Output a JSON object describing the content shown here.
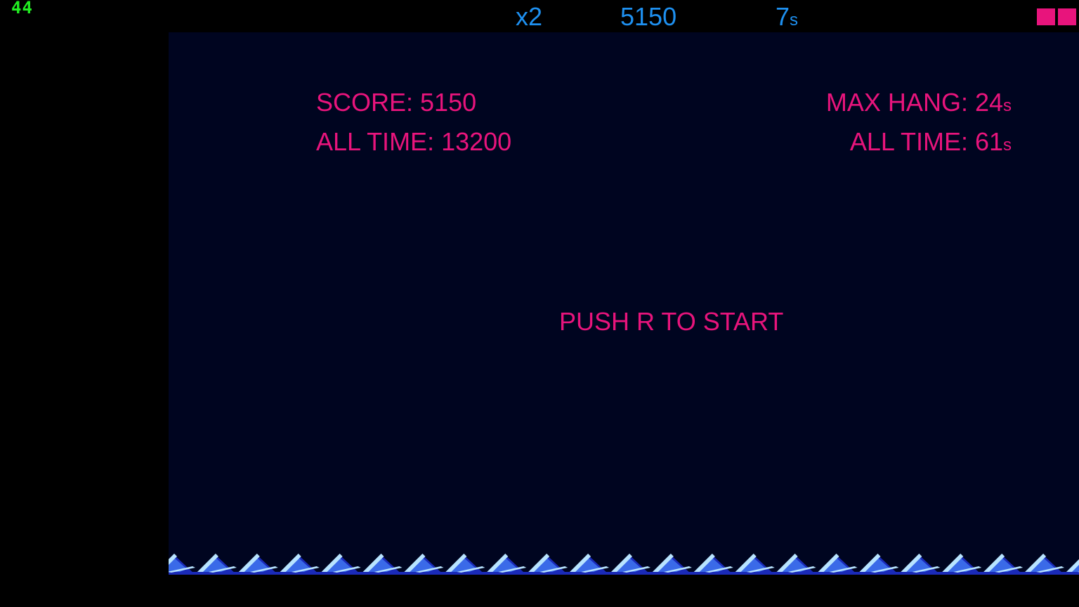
{
  "colors": {
    "background": "#000000",
    "playfield": "#000520",
    "hud_blue": "#1e90f0",
    "magenta": "#e8147c",
    "fps_green": "#22ee22",
    "wave_dark": "#1a2ab8",
    "wave_mid": "#3a6ae8",
    "wave_light": "#b8e4ff"
  },
  "fps": "44",
  "hud": {
    "multiplier": "x2",
    "score": "5150",
    "hang_time_value": "7",
    "hang_time_unit": "s"
  },
  "lives": {
    "count": 2,
    "icon": "life-block-icon"
  },
  "stats": {
    "score_label": "SCORE: 5150",
    "score_all_time_label": "ALL TIME: 13200",
    "max_hang_label": "MAX HANG: 24",
    "max_hang_unit": "s",
    "hang_all_time_label": "ALL TIME: 61",
    "hang_all_time_unit": "s"
  },
  "prompt": "PUSH R TO START",
  "waves": {
    "icon": "water-waves-icon",
    "count": 22
  }
}
